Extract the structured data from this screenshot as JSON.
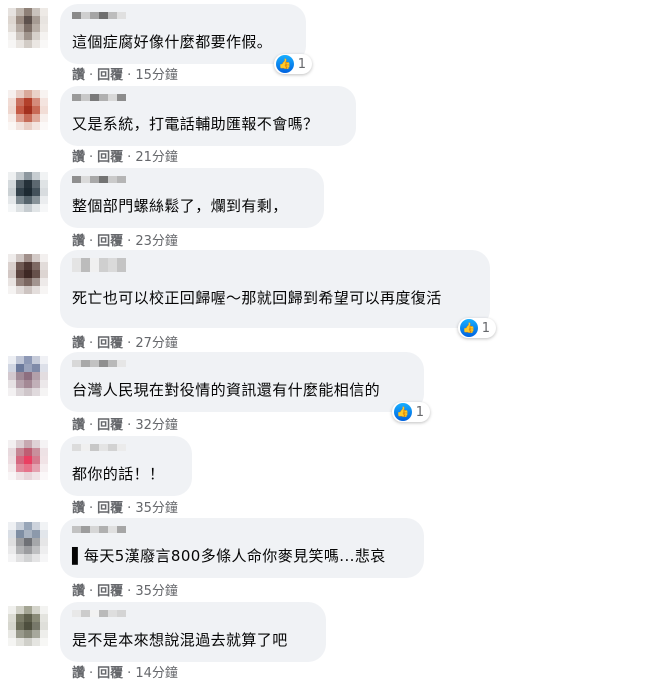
{
  "comments": [
    {
      "text": "這個症腐好像什麼都要作假。",
      "reactions": "1",
      "like": "讚",
      "reply": "回覆",
      "time": "15分鐘",
      "avatar": [
        "#e6e2df",
        "#bfb6ae",
        "#8e8077",
        "#c9c2bc",
        "#eeeae6",
        "#ddd6d0",
        "#9c8d83",
        "#5d514c",
        "#a69b93",
        "#e8e4e0",
        "#e2ddd8",
        "#b5aaa2",
        "#7c6e66",
        "#b8aea6",
        "#ece8e4",
        "#f3f1ef",
        "#cdc6c0",
        "#9f948c",
        "#d6d0ca",
        "#f5f3f1",
        "#f7f6f5",
        "#e9e5e1",
        "#d2ccc6",
        "#ebe7e3",
        "#f9f8f7"
      ],
      "name_colors": [
        "#8a8a8a",
        "#cfcfcf",
        "#a5a5a5",
        "#6f6f6f",
        "#bdbdbd",
        "#e0e0e0"
      ]
    },
    {
      "text": "又是系統，打電話輔助匯報不會嗎？",
      "reactions": "",
      "like": "讚",
      "reply": "回覆",
      "time": "21分鐘",
      "avatar": [
        "#f6f0ee",
        "#e8cfc7",
        "#d9a99a",
        "#ead2c9",
        "#f8f3f1",
        "#f1dcd5",
        "#c97160",
        "#b3402b",
        "#d48b7b",
        "#f4e4df",
        "#efd7cf",
        "#c55a45",
        "#a3301e",
        "#c86a56",
        "#f2ddd6",
        "#f7ece8",
        "#dc9f90",
        "#c66b58",
        "#dfa899",
        "#f8f0ed",
        "#fbf7f5",
        "#f2e3de",
        "#e9cec5",
        "#f3e4df",
        "#fcf9f8"
      ],
      "name_colors": [
        "#9a9a9a",
        "#c8c8c8",
        "#7a7a7a",
        "#b0b0b0",
        "#d8d8d8",
        "#8c8c8c"
      ]
    },
    {
      "text": "整個部門螺絲鬆了，爛到有剩，",
      "reactions": "",
      "like": "讚",
      "reply": "回覆",
      "time": "23分鐘",
      "avatar": [
        "#eef0f1",
        "#c3c9cd",
        "#8d979e",
        "#c7cdd1",
        "#f1f3f4",
        "#d5dadd",
        "#4f5b63",
        "#253139",
        "#5c6870",
        "#dfe3e5",
        "#cbd1d4",
        "#34424b",
        "#1d2a32",
        "#43515a",
        "#d8dcdf",
        "#e5e8ea",
        "#7d8990",
        "#56646c",
        "#889399",
        "#ebedef",
        "#f4f6f7",
        "#dde1e3",
        "#c6ccd0",
        "#e1e5e7",
        "#f6f7f8"
      ],
      "name_colors": [
        "#8f8f8f",
        "#dadada",
        "#a8a8a8",
        "#737373",
        "#cacaca",
        "#b5b5b5"
      ]
    },
    {
      "text": "死亡也可以校正回歸喔～那就回歸到希望可以再度復活",
      "reactions": "1",
      "like": "讚",
      "reply": "回覆",
      "time": "27分鐘",
      "avatar": [
        "#efeceb",
        "#cfc6c3",
        "#a1908b",
        "#d3cac7",
        "#f3f0ef",
        "#dad1ce",
        "#705a54",
        "#4d3632",
        "#7e6963",
        "#e2dcda",
        "#d2c7c4",
        "#5b433e",
        "#3e2824",
        "#66504a",
        "#ddd5d2",
        "#e9e4e2",
        "#94827c",
        "#7b6761",
        "#a39590",
        "#eeeae9",
        "#f5f3f2",
        "#e1dbd9",
        "#cdc4c1",
        "#e4dedc",
        "#f7f5f4"
      ],
      "name_colors": [
        "#e4e4e4",
        "#bcbcbc",
        "#f0f0f0",
        "#cfcfcf",
        "#dadada",
        "#c4c4c4"
      ]
    },
    {
      "text": "台灣人民現在對役情的資訊還有什麼能相信的",
      "reactions": "1",
      "like": "讚",
      "reply": "回覆",
      "time": "32分鐘",
      "avatar": [
        "#eceef3",
        "#c0c6d6",
        "#8e99b6",
        "#c6cbd9",
        "#f0f1f5",
        "#d1d6e2",
        "#6c7a9c",
        "#9aa3bc",
        "#7f8aa8",
        "#dde0e9",
        "#d3c9cf",
        "#a08a97",
        "#8d6f80",
        "#b3a0aa",
        "#e3dde0",
        "#e6e2e4",
        "#b6a2ac",
        "#a48995",
        "#c1b0b8",
        "#ece8ea",
        "#f3f1f2",
        "#dcd6d9",
        "#cfc6ca",
        "#e0dadd",
        "#f5f4f4"
      ],
      "name_colors": [
        "#d8d8d8",
        "#a9a9a9",
        "#c2c2c2",
        "#8f8f8f",
        "#b9b9b9",
        "#e6e6e6"
      ]
    },
    {
      "text": "都你的話！！",
      "reactions": "",
      "like": "讚",
      "reply": "回覆",
      "time": "35分鐘",
      "avatar": [
        "#f3f0f1",
        "#dccfd3",
        "#c7a9b1",
        "#dfd2d6",
        "#f5f3f4",
        "#e8dade",
        "#c58694",
        "#bf5e73",
        "#c98f9c",
        "#eee2e5",
        "#eddde1",
        "#d5677f",
        "#ea3f62",
        "#d57a8d",
        "#f1e3e6",
        "#f3e9eb",
        "#e08a9c",
        "#e7738b",
        "#e4a2b0",
        "#f6eef0",
        "#f9f6f7",
        "#efe3e6",
        "#e8d5da",
        "#f0e4e7",
        "#fbf8f9"
      ],
      "name_colors": [
        "#dcdcdc",
        "#f0f0f0",
        "#c7c7c7",
        "#e4e4e4",
        "#d2d2d2",
        "#ebebeb"
      ]
    },
    {
      "text": "▌每天5漢廢言800多條人命你麥見笑嗎...悲哀",
      "reactions": "",
      "like": "讚",
      "reply": "回覆",
      "time": "35分鐘",
      "avatar": [
        "#eef0f3",
        "#c8cfd9",
        "#98a6b8",
        "#cdd3dc",
        "#f1f3f5",
        "#d9dee5",
        "#7f8ea3",
        "#a9b3c1",
        "#8c99ab",
        "#e2e6eb",
        "#dfdfe0",
        "#9b9c9f",
        "#6f7176",
        "#a5a7aa",
        "#e6e6e7",
        "#eaeaeb",
        "#b3b4b6",
        "#9c9da0",
        "#bfc0c2",
        "#eeeeef",
        "#f4f4f5",
        "#e1e1e2",
        "#d2d3d4",
        "#e4e4e5",
        "#f6f6f7"
      ],
      "name_colors": [
        "#c2c2c2",
        "#9d9d9d",
        "#d6d6d6",
        "#b0b0b0",
        "#e0e0e0",
        "#a6a6a6"
      ]
    },
    {
      "text": "是不是本來想說混過去就算了吧",
      "reactions": "",
      "like": "讚",
      "reply": "回覆",
      "time": "14分鐘",
      "avatar": [
        "#f0f0ed",
        "#d0d0c6",
        "#a4a594",
        "#d4d4cb",
        "#f3f3f1",
        "#dcdcd4",
        "#7c7d69",
        "#5f604d",
        "#8a8b78",
        "#e4e4df",
        "#d6d6ce",
        "#6c6d5a",
        "#4e4f3e",
        "#77786a",
        "#dfdfda",
        "#e8e8e4",
        "#999a8c",
        "#858677",
        "#a7a89c",
        "#eeeeeb",
        "#f5f5f3",
        "#e3e3de",
        "#d0d0ca",
        "#e5e5e1",
        "#f7f7f5"
      ],
      "name_colors": [
        "#e8e8e8",
        "#cccccc",
        "#f2f2f2",
        "#bababa",
        "#dedede",
        "#d4d4d4"
      ]
    }
  ]
}
